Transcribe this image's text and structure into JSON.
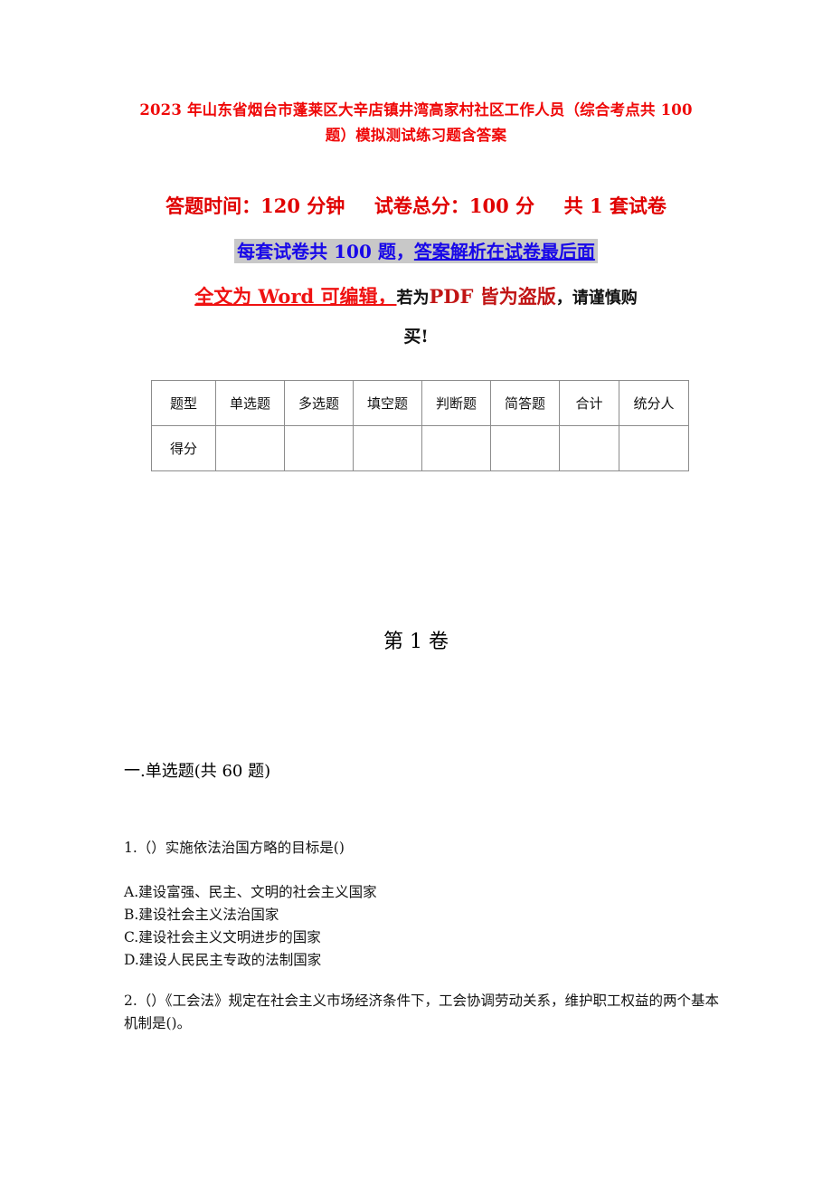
{
  "document": {
    "title": "2023 年山东省烟台市蓬莱区大辛店镇井湾高家村社区工作人员（综合考点共 100 题）模拟测试练习题含答案",
    "colors": {
      "title_red": "#ef0808",
      "info_red": "#e00000",
      "highlight_blue": "#1808e8",
      "highlight_bg": "#c8c8c8",
      "word_red": "#ef1111",
      "pdf_red": "#c11515",
      "table_border": "#8c8c8c"
    }
  },
  "info": {
    "line1": {
      "time_label": "答题时间：120 分钟",
      "total_score_label": "试卷总分：100 分",
      "sets_label": "共 1 套试卷"
    },
    "line2": {
      "part_plain": "每套试卷共 100 题，",
      "part_underlined": "答案解析在试卷最后面"
    },
    "line3": {
      "part_word": "全文为 Word 可编辑，",
      "part_if": "若为",
      "part_pdf": "PDF 皆为盗版",
      "part_tail": "，请谨慎购"
    },
    "line4": "买!"
  },
  "score_table": {
    "headers": [
      "题型",
      "单选题",
      "多选题",
      "填空题",
      "判断题",
      "简答题",
      "合计",
      "统分人"
    ],
    "rows": [
      {
        "label": "得分",
        "values": [
          "",
          "",
          "",
          "",
          "",
          "",
          ""
        ]
      }
    ]
  },
  "volume": {
    "heading": "第 1 卷"
  },
  "section": {
    "heading": "一.单选题(共 60 题)"
  },
  "questions": [
    {
      "number": "1.",
      "stem": "1.（）实施依法治国方略的目标是()",
      "options": [
        "A.建设富强、民主、文明的社会主义国家",
        "B.建设社会主义法治国家",
        "C.建设社会主义文明进步的国家",
        "D.建设人民民主专政的法制国家"
      ]
    },
    {
      "number": "2.",
      "stem": "2.（）《工会法》规定在社会主义市场经济条件下，工会协调劳动关系，维护职工权益的两个基本机制是()。",
      "options": []
    }
  ]
}
